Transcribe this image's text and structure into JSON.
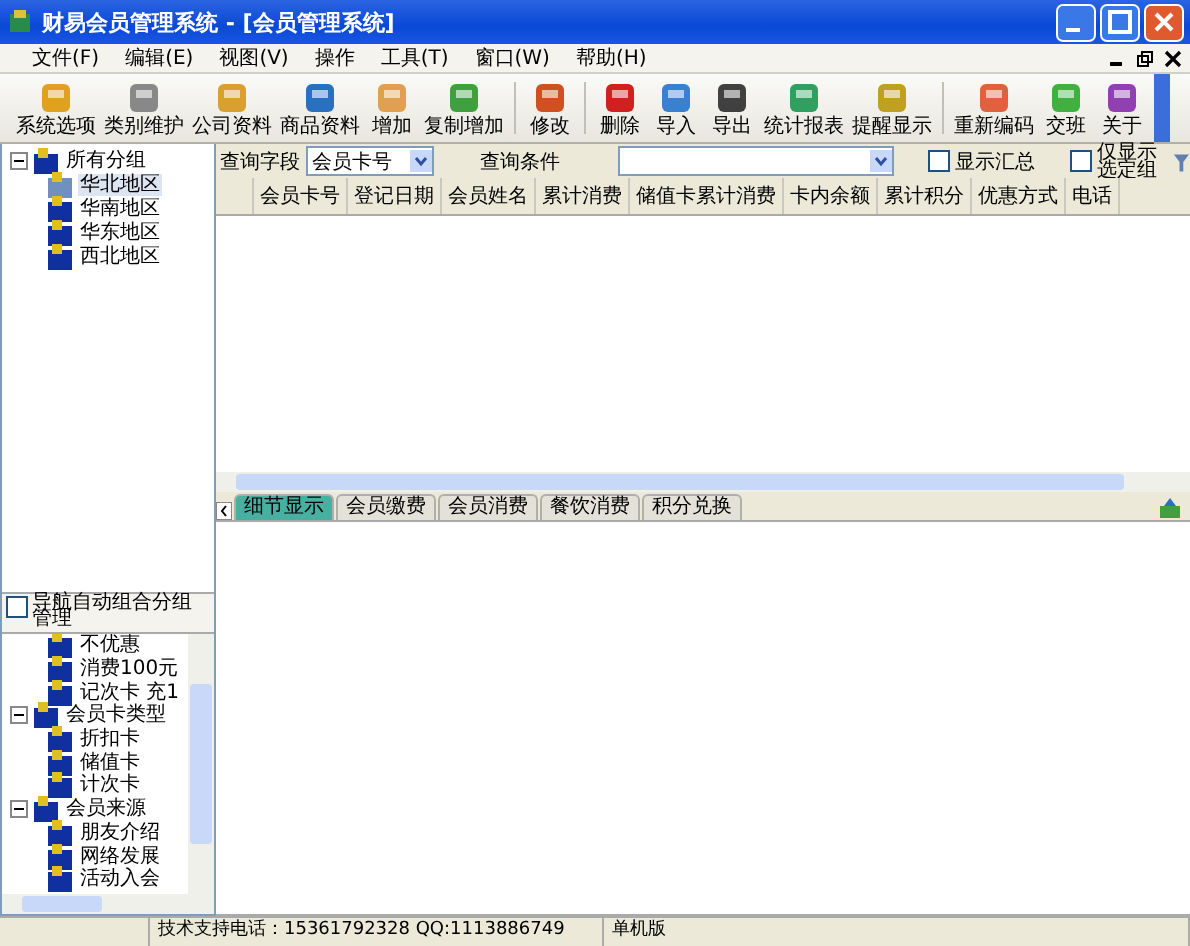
{
  "window": {
    "title": "财易会员管理系统 - [会员管理系统]"
  },
  "menu": [
    "文件(F)",
    "编辑(E)",
    "视图(V)",
    "操作",
    "工具(T)",
    "窗口(W)",
    "帮助(H)"
  ],
  "toolbar_groups": [
    {
      "buttons": [
        "系统选项",
        "类别维护",
        "公司资料",
        "商品资料",
        "增加",
        "复制增加"
      ]
    },
    {
      "buttons": [
        "修改"
      ]
    },
    {
      "buttons": [
        "删除",
        "导入",
        "导出",
        "统计报表",
        "提醒显示"
      ]
    },
    {
      "buttons": [
        "重新编码",
        "交班",
        "关于"
      ]
    }
  ],
  "group_tree": [
    {
      "label": "所有分组",
      "expanded": true,
      "selected": false,
      "children": [
        {
          "label": "华北地区",
          "selected": true
        },
        {
          "label": "华南地区",
          "selected": false
        },
        {
          "label": "华东地区",
          "selected": false
        },
        {
          "label": "西北地区",
          "selected": false
        }
      ]
    }
  ],
  "nav_checkbox": {
    "label": "导航自动组合分组管理",
    "checked": false
  },
  "nav_tree": [
    {
      "label": "不优惠"
    },
    {
      "label": "消费100元"
    },
    {
      "label": "记次卡 充1"
    },
    {
      "label": "会员卡类型",
      "expanded": true,
      "children": [
        {
          "label": "折扣卡"
        },
        {
          "label": "储值卡"
        },
        {
          "label": "计次卡"
        }
      ]
    },
    {
      "label": "会员来源",
      "expanded": true,
      "children": [
        {
          "label": "朋友介绍"
        },
        {
          "label": "网络发展"
        },
        {
          "label": "活动入会"
        }
      ]
    }
  ],
  "query": {
    "field_label": "查询字段",
    "field_value": "会员卡号",
    "condition_label": "查询条件",
    "show_total": {
      "label": "显示汇总",
      "checked": false
    },
    "only_selected": {
      "label": "仅显示选定组",
      "checked": false
    }
  },
  "table": {
    "columns": [
      "会员卡号",
      "登记日期",
      "会员姓名",
      "累计消费",
      "储值卡累计消费",
      "卡内余额",
      "累计积分",
      "优惠方式",
      "电话"
    ]
  },
  "detail_tabs": [
    {
      "label": "细节显示",
      "selected": true
    },
    {
      "label": "会员缴费",
      "selected": false
    },
    {
      "label": "会员消费",
      "selected": false
    },
    {
      "label": "餐饮消费",
      "selected": false
    },
    {
      "label": "积分兑换",
      "selected": false
    }
  ],
  "status_bar": [
    "技术支持电话：15361792328 QQ:1113886749",
    "单机版"
  ]
}
